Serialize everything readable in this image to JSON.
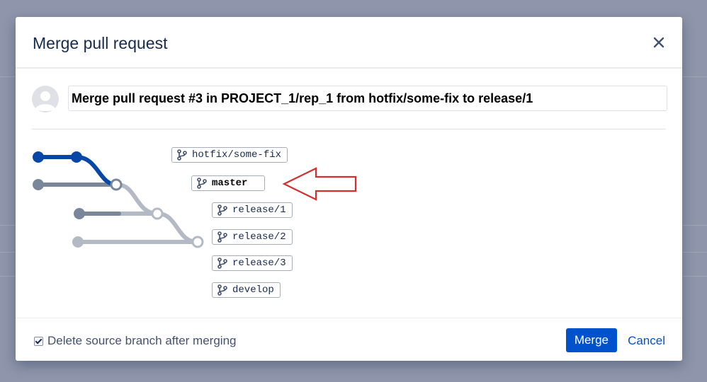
{
  "dialog": {
    "title": "Merge pull request",
    "close_icon": "close-icon"
  },
  "commit": {
    "avatar_icon": "default-avatar-icon",
    "message": "Merge pull request #3 in PROJECT_1/rep_1 from hotfix/some-fix to release/1"
  },
  "graph": {
    "branches": [
      {
        "label": "hotfix/some-fix",
        "icon": "branch-icon"
      },
      {
        "label": "master",
        "icon": "branch-icon"
      },
      {
        "label": "release/1",
        "icon": "branch-icon"
      },
      {
        "label": "release/2",
        "icon": "branch-icon"
      },
      {
        "label": "release/3",
        "icon": "branch-icon"
      },
      {
        "label": "develop",
        "icon": "branch-icon"
      }
    ],
    "colors": {
      "source": "#0747a6",
      "dark_gray": "#7a869a",
      "light_gray": "#b3bac5"
    }
  },
  "annotation": {
    "arrow_color": "#d32f2f"
  },
  "footer": {
    "delete_source_label": "Delete source branch after merging",
    "delete_source_checked": true,
    "merge_label": "Merge",
    "cancel_label": "Cancel",
    "primary_color": "#0052cc"
  }
}
